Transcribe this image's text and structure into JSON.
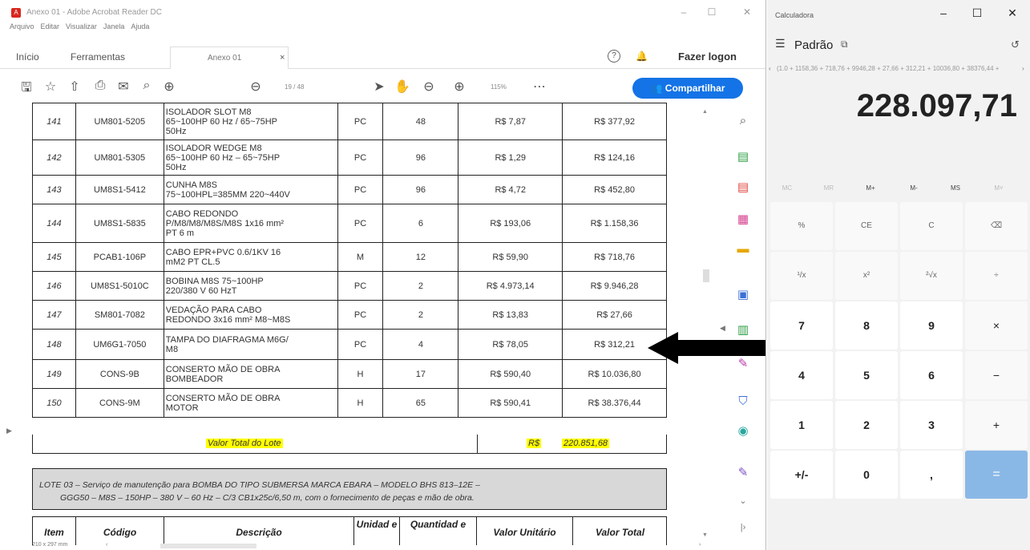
{
  "acrobat": {
    "window_title": "Anexo 01 - Adobe Acrobat Reader DC",
    "menu": [
      "Arquivo",
      "Editar",
      "Visualizar",
      "Janela",
      "Ajuda"
    ],
    "nav_tabs": [
      "Início",
      "Ferramentas"
    ],
    "doc_tab": "Anexo 01",
    "login": "Fazer logon",
    "page_display": "19 / 48",
    "zoom": "115%",
    "share": "Compartilhar",
    "page_size": "210 x 297 mm",
    "rows": [
      {
        "item": "141",
        "code": "UM801-5205",
        "desc_lines": [
          "ISOLADOR SLOT M8",
          "65~100HP 60 Hz / 65~75HP",
          "50Hz"
        ],
        "unit": "PC",
        "qty": "48",
        "unit_value": "R$ 7,87",
        "total": "R$ 377,92"
      },
      {
        "item": "142",
        "code": "UM801-5305",
        "desc_lines": [
          "ISOLADOR WEDGE M8",
          "65~100HP 60 Hz – 65~75HP",
          "50Hz"
        ],
        "unit": "PC",
        "qty": "96",
        "unit_value": "R$ 1,29",
        "total": "R$ 124,16"
      },
      {
        "item": "143",
        "code": "UM8S1-5412",
        "desc_lines": [
          "CUNHA M8S",
          "75~100HPL=385MM 220~440V"
        ],
        "unit": "PC",
        "qty": "96",
        "unit_value": "R$ 4,72",
        "total": "R$ 452,80"
      },
      {
        "item": "144",
        "code": "UM8S1-5835",
        "desc_lines": [
          "CABO REDONDO",
          "P/M8/M8/M8S/M8S 1x16 mm²",
          "PT 6 m"
        ],
        "unit": "PC",
        "qty": "6",
        "unit_value": "R$ 193,06",
        "total": "R$ 1.158,36"
      },
      {
        "item": "145",
        "code": "PCAB1-106P",
        "desc_lines": [
          "CABO EPR+PVC 0.6/1KV 16",
          "mM2 PT CL.5"
        ],
        "unit": "M",
        "qty": "12",
        "unit_value": "R$ 59,90",
        "total": "R$ 718,76"
      },
      {
        "item": "146",
        "code": "UM8S1-5010C",
        "desc_lines": [
          "BOBINA M8S 75~100HP",
          "220/380 V 60 HzT"
        ],
        "unit": "PC",
        "qty": "2",
        "unit_value": "R$ 4.973,14",
        "total": "R$ 9.946,28"
      },
      {
        "item": "147",
        "code": "SM801-7082",
        "desc_lines": [
          "VEDAÇÃO PARA CABO",
          "REDONDO 3x16 mm² M8~M8S"
        ],
        "unit": "PC",
        "qty": "2",
        "unit_value": "R$ 13,83",
        "total": "R$ 27,66"
      },
      {
        "item": "148",
        "code": "UM6G1-7050",
        "desc_lines": [
          "TAMPA DO DIAFRAGMA M6G/",
          "M8"
        ],
        "unit": "PC",
        "qty": "4",
        "unit_value": "R$ 78,05",
        "total": "R$ 312,21"
      },
      {
        "item": "149",
        "code": "CONS-9B",
        "desc_lines": [
          "CONSERTO MÃO DE OBRA",
          "BOMBEADOR"
        ],
        "unit": "H",
        "qty": "17",
        "unit_value": "R$ 590,40",
        "total": "R$ 10.036,80"
      },
      {
        "item": "150",
        "code": "CONS-9M",
        "desc_lines": [
          "CONSERTO MÃO DE OBRA",
          "MOTOR"
        ],
        "unit": "H",
        "qty": "65",
        "unit_value": "R$ 590,41",
        "total": "R$ 38.376,44"
      }
    ],
    "total_label": "Valor Total do Lote",
    "total_currency": "R$",
    "total_value": "220.851,68",
    "lote_line1": "LOTE 03 – Serviço de manutenção para BOMBA DO TIPO SUBMERSA MARCA EBARA – MODELO BHS 813–12E –",
    "lote_line2": "GGG50 – M8S – 150HP – 380 V – 60 Hz – C/3 CB1x25c/6,50 m, com o fornecimento de peças e mão de obra.",
    "headers": [
      "Item",
      "Código",
      "Descrição",
      "Unidad e",
      "Quantidad e",
      "Valor Unitário",
      "Valor Total"
    ]
  },
  "calculator": {
    "window_title": "Calculadora",
    "mode": "Padrão",
    "expression": "(1.0 + 1158,36 + 718,76 + 9946,28 + 27,66 + 312,21 + 10036,80 + 38376,44 +",
    "display": "228.097,71",
    "memory": [
      "MC",
      "MR",
      "M+",
      "M-",
      "MS",
      "M˅"
    ],
    "keys": [
      [
        "%",
        "CE",
        "C",
        "⌫"
      ],
      [
        "¹/x",
        "x²",
        "²√x",
        "÷"
      ],
      [
        "7",
        "8",
        "9",
        "×"
      ],
      [
        "4",
        "5",
        "6",
        "−"
      ],
      [
        "1",
        "2",
        "3",
        "+"
      ],
      [
        "+/-",
        "0",
        ",",
        "="
      ]
    ]
  }
}
